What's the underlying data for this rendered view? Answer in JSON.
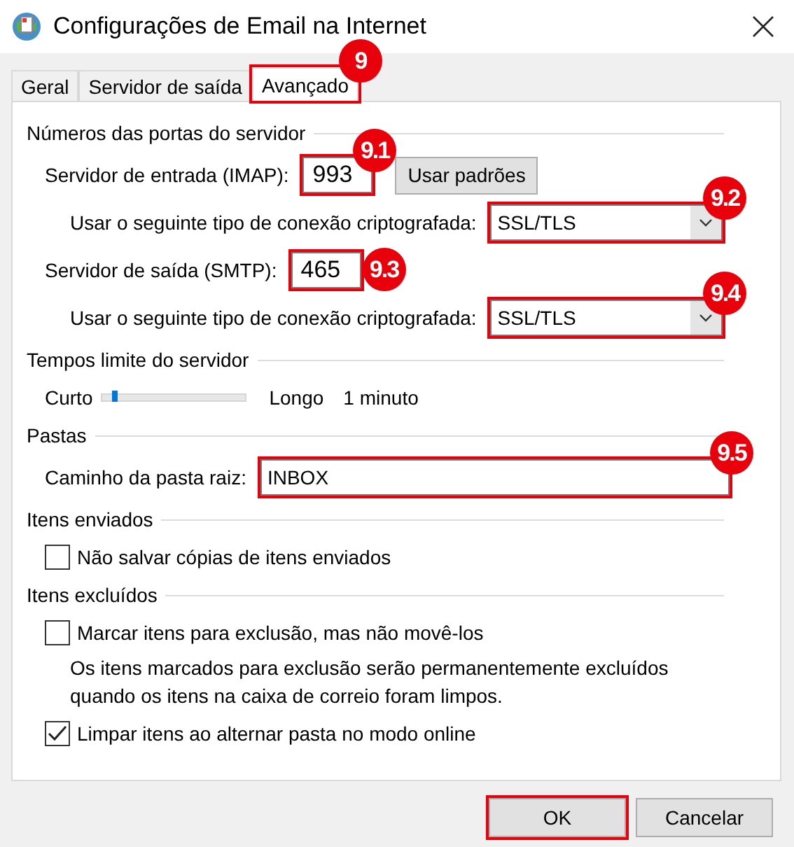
{
  "window": {
    "title": "Configurações de Email na Internet"
  },
  "tabs": [
    {
      "label": "Geral",
      "selected": false,
      "highlighted": false
    },
    {
      "label": "Servidor de saída",
      "selected": false,
      "highlighted": false
    },
    {
      "label": "Avançado",
      "selected": true,
      "highlighted": true,
      "callout": "9"
    }
  ],
  "groups": [
    {
      "title": "Números das portas do servidor",
      "rows": [
        {
          "kind": "port",
          "label": "Servidor de entrada (IMAP):",
          "value": "993",
          "highlighted": true,
          "callout": "9.1",
          "button": "Usar padrões"
        },
        {
          "kind": "combo",
          "label": "Usar o seguinte tipo de conexão criptografada:",
          "value": "SSL/TLS",
          "highlighted": true,
          "callout": "9.2"
        },
        {
          "kind": "port",
          "label": "Servidor de saída (SMTP):",
          "value": "465",
          "highlighted": true,
          "callout": "9.3"
        },
        {
          "kind": "combo",
          "label": "Usar o seguinte tipo de conexão criptografada:",
          "value": "SSL/TLS",
          "highlighted": true,
          "callout": "9.4"
        }
      ]
    },
    {
      "title": "Tempos limite do servidor",
      "rows": [
        {
          "kind": "slider",
          "min_label": "Curto",
          "max_label": "Longo",
          "reading": "1 minuto",
          "level": 0.09
        }
      ]
    },
    {
      "title": "Pastas",
      "rows": [
        {
          "kind": "text",
          "label": "Caminho da pasta raiz:",
          "value": "INBOX",
          "highlighted": true,
          "callout": "9.5"
        }
      ]
    },
    {
      "title": "Itens enviados",
      "rows": [
        {
          "kind": "checkbox",
          "label": "Não salvar cópias de itens enviados",
          "checked": false
        }
      ]
    },
    {
      "title": "Itens excluídos",
      "rows": [
        {
          "kind": "checkbox",
          "label": "Marcar itens para exclusão, mas não movê-los",
          "checked": false
        },
        {
          "kind": "note",
          "text": "Os itens marcados para exclusão serão permanentemente excluídos quando os itens na caixa de correio foram limpos."
        },
        {
          "kind": "checkbox",
          "label": "Limpar itens ao alternar pasta no modo online",
          "checked": true
        }
      ]
    }
  ],
  "buttons": [
    {
      "label": "OK",
      "highlighted": true
    },
    {
      "label": "Cancelar",
      "highlighted": false
    }
  ]
}
